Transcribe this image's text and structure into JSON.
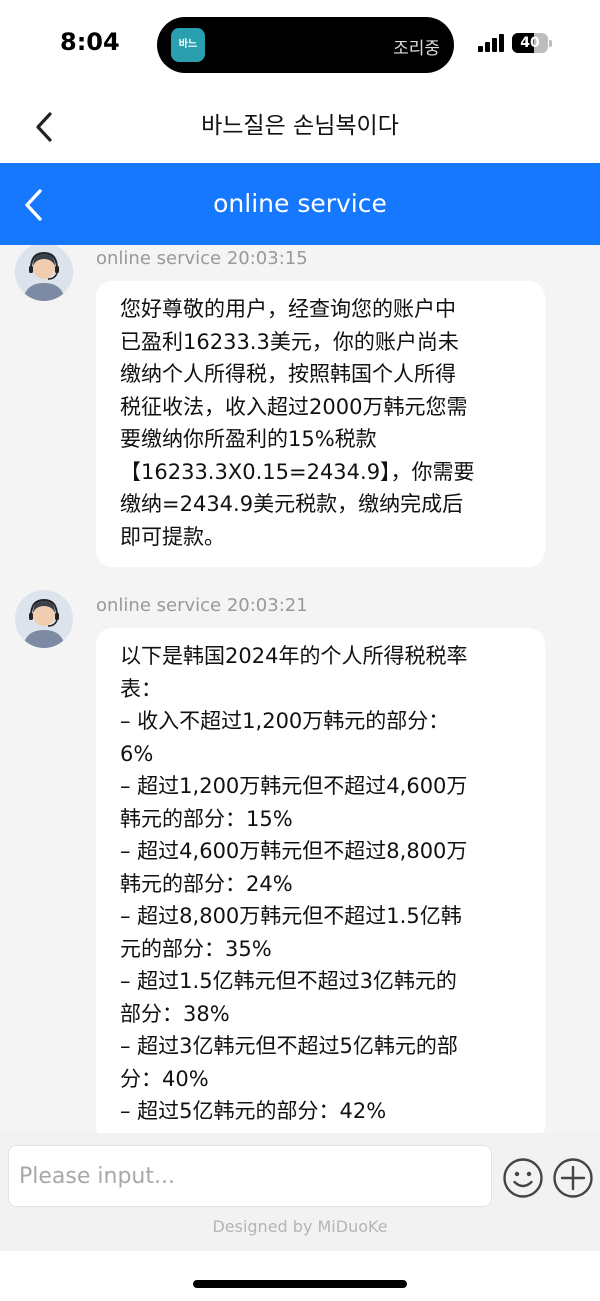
{
  "status_bar": {
    "time": "8:04",
    "island_app_label": "바느",
    "island_activity": "조리중",
    "battery_level": "40"
  },
  "title_bar": {
    "back_icon": "chevron-left-icon",
    "title": "바느질은 손님복이다"
  },
  "service_header": {
    "back_icon": "chevron-left-icon",
    "title": "online service",
    "color": "#1677ff"
  },
  "messages": [
    {
      "sender": "online service 20:03:15",
      "lines": [
        "您好尊敬的用户，经查询您的账户中",
        "已盈利16233.3美元，你的账户尚未",
        "缴纳个人所得税，按照韩国个人所得",
        "税征收法，收入超过2000万韩元您需",
        "要缴纳你所盈利的15%税款",
        "【16233.3X0.15=2434.9】，你需要",
        "缴纳=2434.9美元税款，缴纳完成后",
        "即可提款。"
      ]
    },
    {
      "sender": "online service 20:03:21",
      "lines": [
        "以下是韩国2024年的个人所得税税率",
        "表：",
        "– 收入不超过1,200万韩元的部分：",
        "6%",
        "– 超过1,200万韩元但不超过4,600万",
        "韩元的部分：15%",
        "– 超过4,600万韩元但不超过8,800万",
        "韩元的部分：24%",
        "– 超过8,800万韩元但不超过1.5亿韩",
        "元的部分：35%",
        "– 超过1.5亿韩元但不超过3亿韩元的",
        "部分：38%",
        "– 超过3亿韩元但不超过5亿韩元的部",
        "分：40%",
        "– 超过5亿韩元的部分：42%"
      ]
    }
  ],
  "input": {
    "placeholder": "Please input...",
    "value": "",
    "emoji_icon": "emoji-smile-icon",
    "plus_icon": "plus-circle-icon"
  },
  "footer": {
    "text": "Designed by MiDuoKe"
  }
}
